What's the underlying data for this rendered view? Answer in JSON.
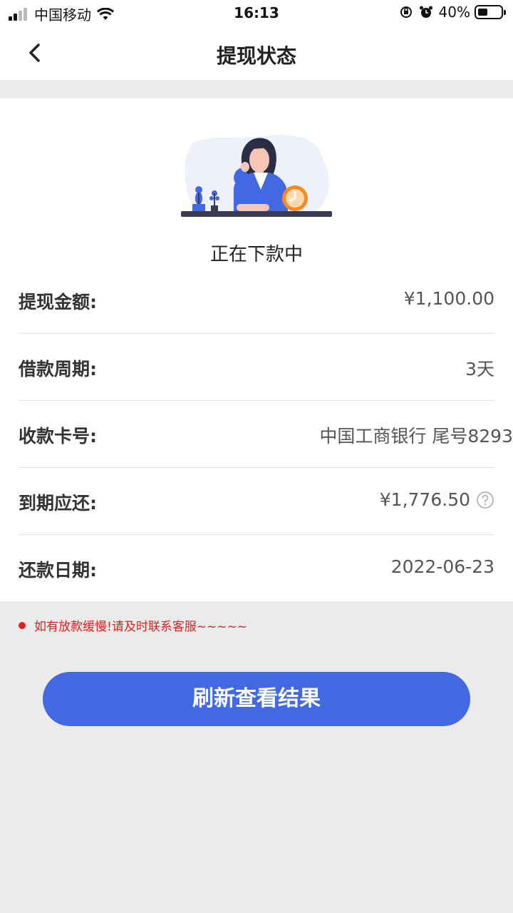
{
  "status_bar": {
    "carrier": "中国移动",
    "time": "16:13",
    "battery": "40%",
    "battery_level": 0.4
  },
  "nav": {
    "title": "提现状态"
  },
  "status": {
    "text": "正在下款中"
  },
  "details": [
    {
      "label": "提现金额:",
      "value": "¥1,100.00"
    },
    {
      "label": "借款周期:",
      "value": "3天"
    },
    {
      "label": "收款卡号:",
      "value": "中国工商银行 尾号8293"
    },
    {
      "label": "到期应还:",
      "value": "¥1,776.50"
    },
    {
      "label": "还款日期:",
      "value": "2022-06-23"
    }
  ],
  "notice": "如有放款缓慢!请及时联系客服~~~~~",
  "button": {
    "label": "刷新查看结果"
  },
  "colors": {
    "accent": "#4268e2",
    "notice": "#e02020",
    "background": "#ebebeb"
  }
}
